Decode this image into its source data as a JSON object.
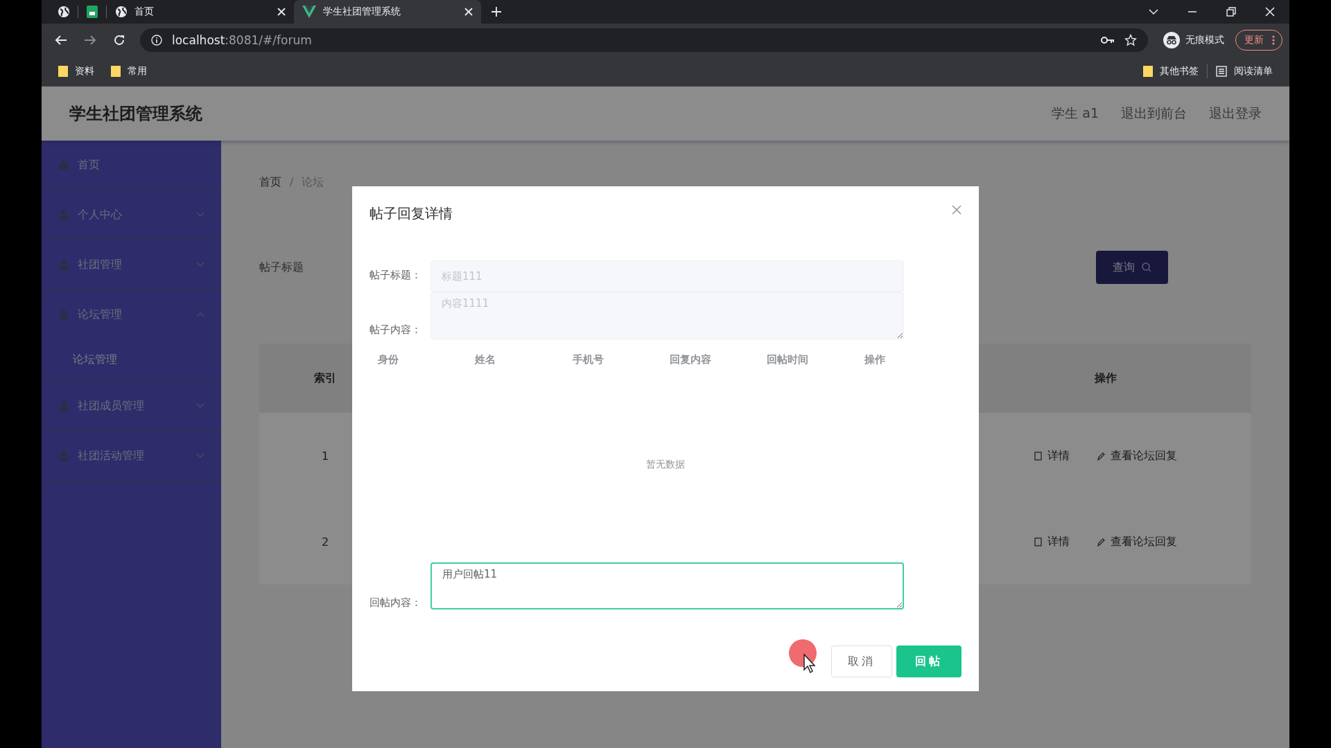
{
  "browser": {
    "tabs": [
      {
        "kind": "globe",
        "title": "首页",
        "selected": false
      },
      {
        "kind": "vue",
        "title": "学生社团管理系统",
        "selected": true
      }
    ],
    "url": {
      "host": "localhost",
      "rest": ":8081/#/forum"
    },
    "profile": "无痕模式",
    "update_button": "更新",
    "bookmarks": [
      "资料",
      "常用"
    ],
    "other_bookmarks": "其他书签",
    "reading_list": "阅读清单"
  },
  "header": {
    "title": "学生社团管理系统",
    "links": [
      "学生 a1",
      "退出到前台",
      "退出登录"
    ]
  },
  "sidebar": {
    "items": [
      {
        "kind": "link",
        "label": "首页"
      },
      {
        "kind": "submenu",
        "label": "个人中心",
        "expanded": false
      },
      {
        "kind": "submenu",
        "label": "社团管理",
        "expanded": false
      },
      {
        "kind": "submenu",
        "label": "论坛管理",
        "expanded": true,
        "children": [
          {
            "label": "论坛管理"
          }
        ]
      },
      {
        "kind": "submenu",
        "label": "社团成员管理",
        "expanded": false
      },
      {
        "kind": "submenu",
        "label": "社团活动管理",
        "expanded": false
      }
    ]
  },
  "breadcrumb": [
    "首页",
    "/",
    "论坛"
  ],
  "search": {
    "label": "帖子标题",
    "button": "查询"
  },
  "table": {
    "columns": [
      "索引",
      "操作"
    ],
    "rows": [
      {
        "index": "1",
        "actions": [
          "详情",
          "查看论坛回复"
        ]
      },
      {
        "index": "2",
        "actions": [
          "详情",
          "查看论坛回复"
        ]
      }
    ]
  },
  "dialog": {
    "title": "帖子回复详情",
    "post_title": {
      "label": "帖子标题：",
      "value": "标题111",
      "disabled": true
    },
    "post_content": {
      "label": "帖子内容：",
      "value": "内容1111",
      "disabled": true
    },
    "replies": {
      "columns": [
        "身份",
        "姓名",
        "手机号",
        "回复内容",
        "回帖时间",
        "操作"
      ],
      "empty_text": "暂无数据"
    },
    "reply": {
      "label": "回帖内容：",
      "value": "用户回帖11",
      "focused": true
    },
    "buttons": [
      {
        "kind": "secondary",
        "label": "取消"
      },
      {
        "kind": "primary",
        "label": "回帖"
      }
    ]
  }
}
